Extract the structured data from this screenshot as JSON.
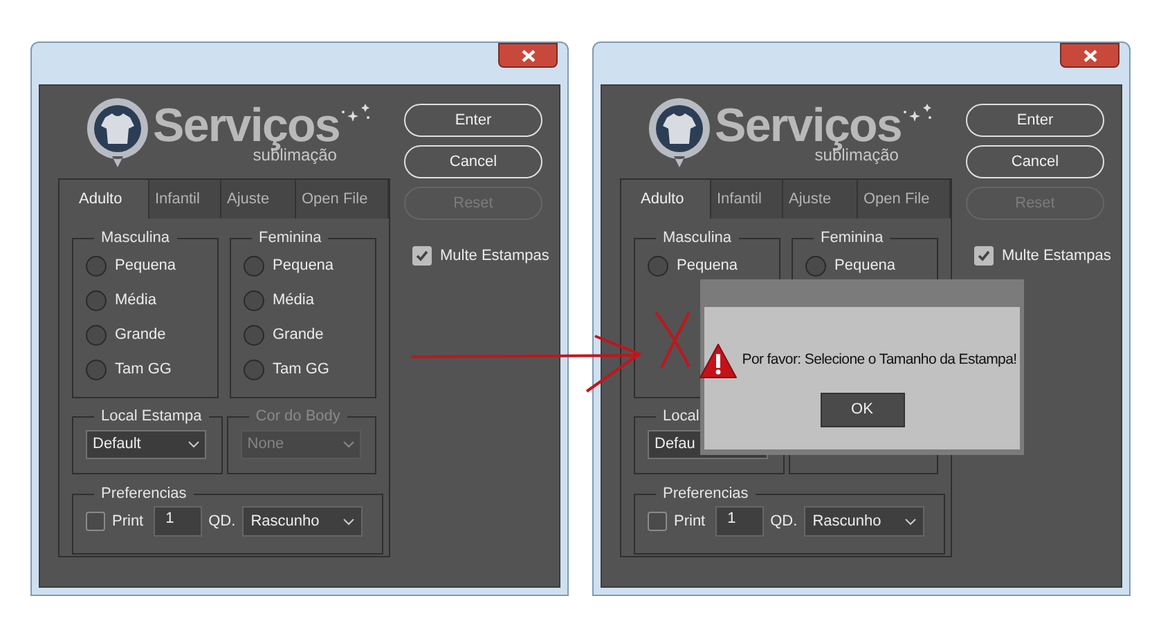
{
  "windows": [
    {
      "logo": {
        "title": "Serviços",
        "subtitle": "sublimação"
      },
      "buttons": [
        {
          "label": "Enter",
          "disabled": false
        },
        {
          "label": "Cancel",
          "disabled": false
        },
        {
          "label": "Reset",
          "disabled": true
        }
      ],
      "multi_checkbox": {
        "label": "Multe Estampas",
        "checked": true
      },
      "tabs": [
        {
          "label": "Adulto",
          "selected": true
        },
        {
          "label": "Infantil",
          "selected": false
        },
        {
          "label": "Ajuste",
          "selected": false
        },
        {
          "label": "Open File",
          "selected": false
        }
      ],
      "size_groups": [
        {
          "title": "Masculina",
          "options": [
            {
              "label": "Pequena",
              "selected": false
            },
            {
              "label": "Média",
              "selected": false
            },
            {
              "label": "Grande",
              "selected": false
            },
            {
              "label": "Tam GG",
              "selected": false
            }
          ]
        },
        {
          "title": "Feminina",
          "options": [
            {
              "label": "Pequena",
              "selected": false
            },
            {
              "label": "Média",
              "selected": false
            },
            {
              "label": "Grande",
              "selected": false
            },
            {
              "label": "Tam GG",
              "selected": false
            }
          ]
        }
      ],
      "select_groups": [
        {
          "title": "Local Estampa",
          "value": "Default",
          "disabled": false
        },
        {
          "title": "Cor do Body",
          "value": "None",
          "disabled": true
        }
      ],
      "preferences": {
        "title": "Preferencias",
        "print": {
          "label": "Print",
          "checked": false
        },
        "copies": "1",
        "quality_label": "QD.",
        "quality": "Rascunho"
      }
    },
    {
      "logo": {
        "title": "Serviços",
        "subtitle": "sublimação"
      },
      "buttons": [
        {
          "label": "Enter",
          "disabled": false
        },
        {
          "label": "Cancel",
          "disabled": false
        },
        {
          "label": "Reset",
          "disabled": true
        }
      ],
      "multi_checkbox": {
        "label": "Multe Estampas",
        "checked": true
      },
      "tabs": [
        {
          "label": "Adulto",
          "selected": true
        },
        {
          "label": "Infantil",
          "selected": false
        },
        {
          "label": "Ajuste",
          "selected": false
        },
        {
          "label": "Open File",
          "selected": false
        }
      ],
      "size_groups": [
        {
          "title": "Masculina",
          "options": [
            {
              "label": "Pequena",
              "selected": false
            }
          ]
        },
        {
          "title": "Feminina",
          "options": [
            {
              "label": "Pequena",
              "selected": false
            }
          ]
        }
      ],
      "select_groups": [
        {
          "title": "Local",
          "value": "Defau",
          "disabled": false
        }
      ],
      "preferences": {
        "title": "Preferencias",
        "print": {
          "label": "Print",
          "checked": false
        },
        "copies": "1",
        "quality_label": "QD.",
        "quality": "Rascunho"
      },
      "dialog": {
        "message": "Por favor: Selecione o Tamanho da Estampa!",
        "button": "OK"
      }
    }
  ]
}
